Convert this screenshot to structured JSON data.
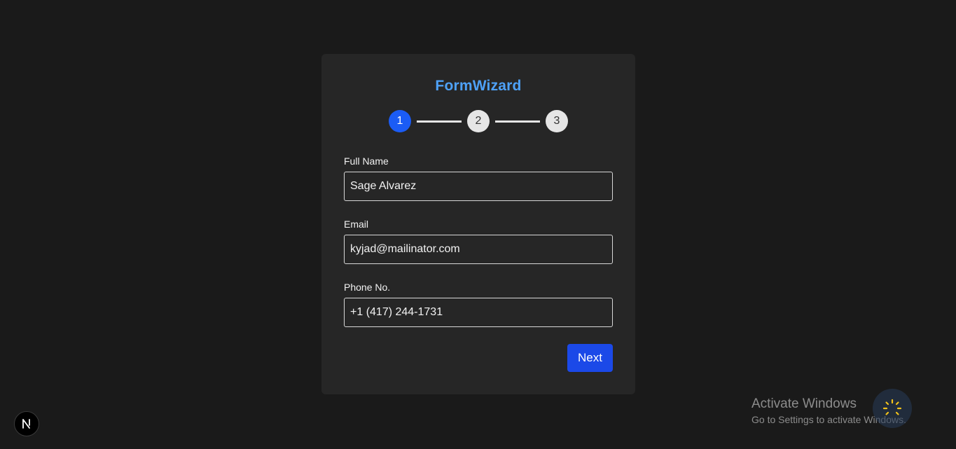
{
  "app": {
    "title": "FormWizard"
  },
  "stepper": {
    "steps": [
      {
        "label": "1",
        "state": "active"
      },
      {
        "label": "2",
        "state": "inactive"
      },
      {
        "label": "3",
        "state": "inactive"
      }
    ]
  },
  "form": {
    "full_name": {
      "label": "Full Name",
      "value": "Sage Alvarez"
    },
    "email": {
      "label": "Email",
      "value": "kyjad@mailinator.com"
    },
    "phone": {
      "label": "Phone No.",
      "value": "+1 (417) 244-1731"
    },
    "next_label": "Next"
  },
  "overlay": {
    "nextjs_badge_icon": "nextjs-n-icon",
    "activate_title": "Activate Windows",
    "activate_subtitle": "Go to Settings to activate Windows.",
    "spinner_icon": "loading-spinner-icon"
  },
  "colors": {
    "background": "#1a1a1a",
    "card": "#262626",
    "title": "#4ea1f7",
    "step_active": "#1b5cf5",
    "step_inactive": "#e6e6e6",
    "button": "#1b49e8"
  }
}
